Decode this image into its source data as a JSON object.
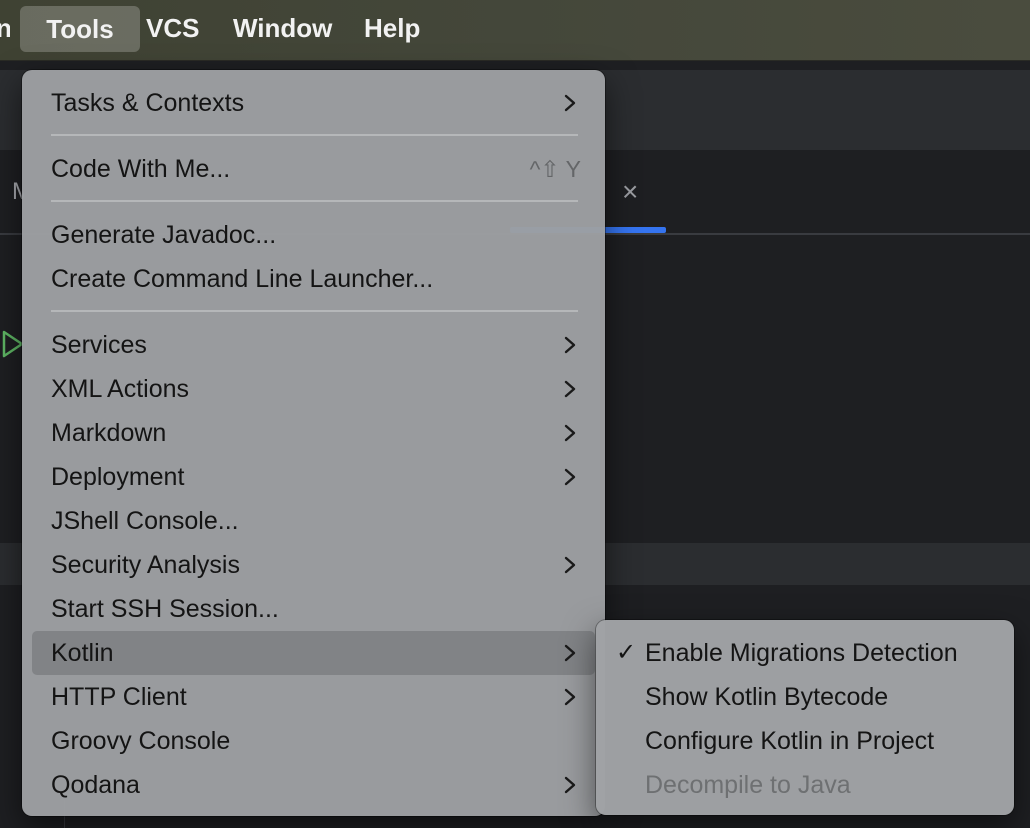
{
  "menubar": {
    "partial_item": "n",
    "items": [
      "Tools",
      "VCS",
      "Window",
      "Help"
    ]
  },
  "ide": {
    "tab_fragment": "M",
    "tab_close_glyph": "×"
  },
  "tools_menu": {
    "items": [
      {
        "label": "Tasks & Contexts",
        "submenu": true
      },
      {
        "label": "Code With Me...",
        "shortcut": "^⇧ Y"
      },
      {
        "label": "Generate Javadoc..."
      },
      {
        "label": "Create Command Line Launcher..."
      },
      {
        "label": "Services",
        "submenu": true
      },
      {
        "label": "XML Actions",
        "submenu": true
      },
      {
        "label": "Markdown",
        "submenu": true
      },
      {
        "label": "Deployment",
        "submenu": true
      },
      {
        "label": "JShell Console..."
      },
      {
        "label": "Security Analysis",
        "submenu": true
      },
      {
        "label": "Start SSH Session..."
      },
      {
        "label": "Kotlin",
        "submenu": true,
        "highlighted": true
      },
      {
        "label": "HTTP Client",
        "submenu": true
      },
      {
        "label": "Groovy Console"
      },
      {
        "label": "Qodana",
        "submenu": true
      }
    ]
  },
  "kotlin_submenu": {
    "check_glyph": "✓",
    "items": [
      {
        "label": "Enable Migrations Detection",
        "checked": true
      },
      {
        "label": "Show Kotlin Bytecode"
      },
      {
        "label": "Configure Kotlin in Project"
      },
      {
        "label": "Decompile to Java",
        "disabled": true
      }
    ]
  },
  "colors": {
    "menubar_bg": "#44473a",
    "menu_bg": "#9d9fa2",
    "menu_highlight": "#818386",
    "menu_text": "#141414",
    "disabled_text": "#6e7072",
    "accent_tab": "#3574f0",
    "ide_bg": "#1e1f22",
    "run_icon": "#5fb865"
  },
  "icons": {
    "submenu_arrow": "chevron-right-icon",
    "tab_close": "close-icon",
    "run": "run-gutter-icon",
    "checkmark": "checkmark-icon"
  }
}
